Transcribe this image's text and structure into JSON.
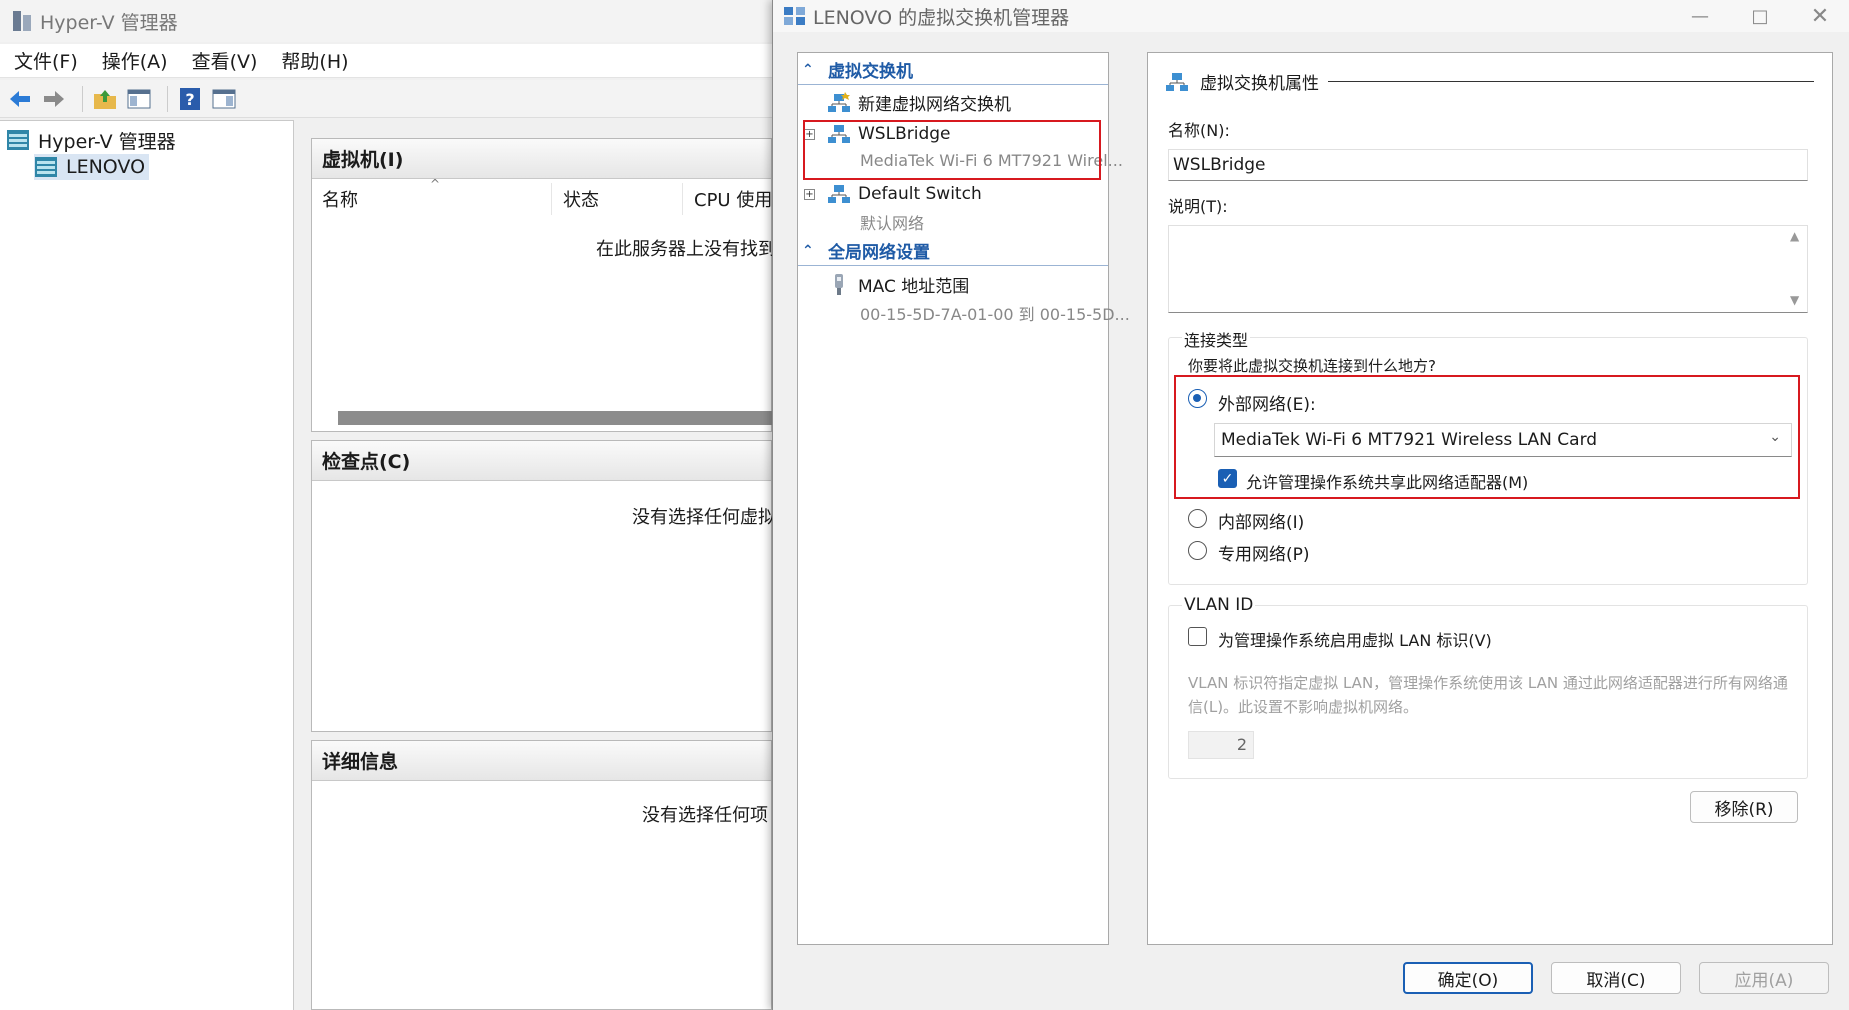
{
  "manager": {
    "title": "Hyper-V 管理器",
    "menu": [
      "文件(F)",
      "操作(A)",
      "查看(V)",
      "帮助(H)"
    ],
    "tree": {
      "root": "Hyper-V 管理器",
      "server": "LENOVO"
    },
    "vm_panel": {
      "title": "虚拟机(I)",
      "columns": [
        "名称",
        "状态",
        "CPU 使用"
      ],
      "empty_message": "在此服务器上没有找到"
    },
    "checkpoint_panel": {
      "title": "检查点(C)",
      "empty_message": "没有选择任何虚拟"
    },
    "details_panel": {
      "title": "详细信息",
      "empty_message": "没有选择任何项"
    }
  },
  "dialog": {
    "title": "LENOVO 的虚拟交换机管理器",
    "nav": {
      "section_switches": "虚拟交换机",
      "new_switch": "新建虚拟网络交换机",
      "items": [
        {
          "name": "WSLBridge",
          "sub": "MediaTek Wi-Fi 6 MT7921 Wirel..."
        },
        {
          "name": "Default Switch",
          "sub": "默认网络"
        }
      ],
      "section_global": "全局网络设置",
      "mac": {
        "name": "MAC 地址范围",
        "sub": "00-15-5D-7A-01-00 到 00-15-5D..."
      }
    },
    "props": {
      "header": "虚拟交换机属性",
      "name_label": "名称(N):",
      "name_value": "WSLBridge",
      "desc_label": "说明(T):",
      "conn_type_label": "连接类型",
      "conn_question": "你要将此虚拟交换机连接到什么地方?",
      "external_label": "外部网络(E):",
      "adapter_selected": "MediaTek Wi-Fi 6 MT7921 Wireless LAN Card",
      "share_label": "允许管理操作系统共享此网络适配器(M)",
      "internal_label": "内部网络(I)",
      "private_label": "专用网络(P)",
      "vlan_group": "VLAN ID",
      "vlan_enable_label": "为管理操作系统启用虚拟 LAN 标识(V)",
      "vlan_help": "VLAN 标识符指定虚拟 LAN，管理操作系统使用该 LAN 通过此网络适配器进行所有网络通信(L)。此设置不影响虚拟机网络。",
      "vlan_value": "2",
      "remove_button": "移除(R)"
    },
    "buttons": {
      "ok": "确定(O)",
      "cancel": "取消(C)",
      "apply": "应用(A)"
    }
  }
}
